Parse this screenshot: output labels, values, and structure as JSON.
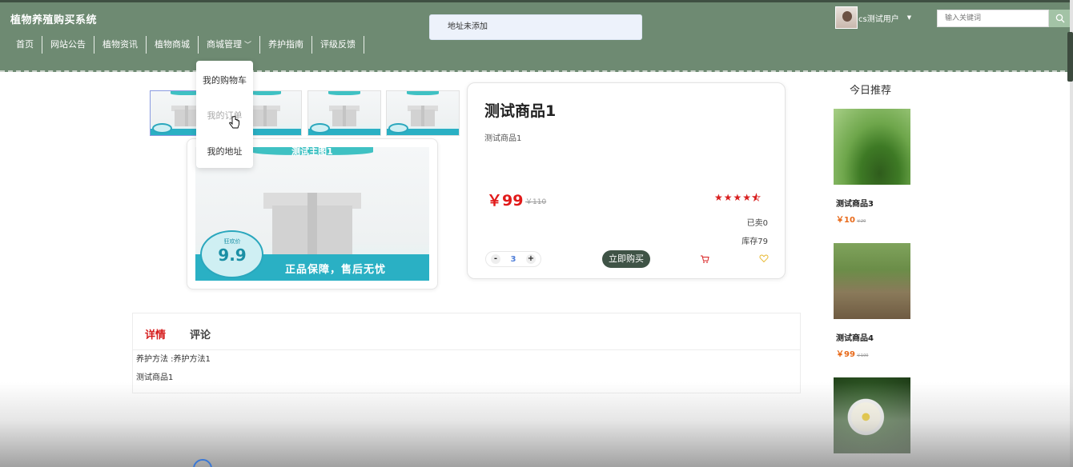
{
  "header": {
    "brand": "植物养殖购买系统",
    "nav": [
      {
        "label": "首页"
      },
      {
        "label": "网站公告"
      },
      {
        "label": "植物资讯"
      },
      {
        "label": "植物商城"
      },
      {
        "label": "商城管理",
        "has_chevron": true
      },
      {
        "label": "养护指南"
      },
      {
        "label": "评级反馈"
      }
    ],
    "user": {
      "name": "cs测试用户"
    },
    "search": {
      "placeholder": "输入关键词"
    }
  },
  "toast": {
    "message": "地址未添加"
  },
  "dropdown": {
    "items": [
      {
        "label": "我的购物车"
      },
      {
        "label": "我的订单"
      },
      {
        "label": "我的地址"
      }
    ],
    "hovered_index": 1
  },
  "gallery": {
    "banner_title": "测试主图1",
    "badge_top": "狂欢价",
    "badge_price": "9.9",
    "slogan": "正品保障，售后无忧"
  },
  "product": {
    "name": "测试商品1",
    "description": "测试商品1",
    "price": "￥99",
    "original_price": "￥110",
    "rating": 4.5,
    "sold": "已卖0",
    "stock": "库存79",
    "quantity": "3",
    "decrement": "-",
    "increment": "+",
    "buy_label": "立即购买"
  },
  "detail": {
    "tabs": [
      {
        "label": "详情",
        "active": true
      },
      {
        "label": "评论",
        "active": false
      }
    ],
    "care": "养护方法 :养护方法1",
    "text": "测试商品1"
  },
  "recommend": {
    "title": "今日推荐",
    "items": [
      {
        "name": "测试商品3",
        "price": "￥10",
        "original": "￥20"
      },
      {
        "name": "测试商品4",
        "price": "￥99",
        "original": "￥100"
      },
      {
        "name": "",
        "price": "",
        "original": ""
      }
    ]
  },
  "colors": {
    "header_bg": "#6e8a72",
    "price_red": "#e11a1a",
    "buy_button": "#3f5346",
    "rec_price": "#e86a1a"
  }
}
